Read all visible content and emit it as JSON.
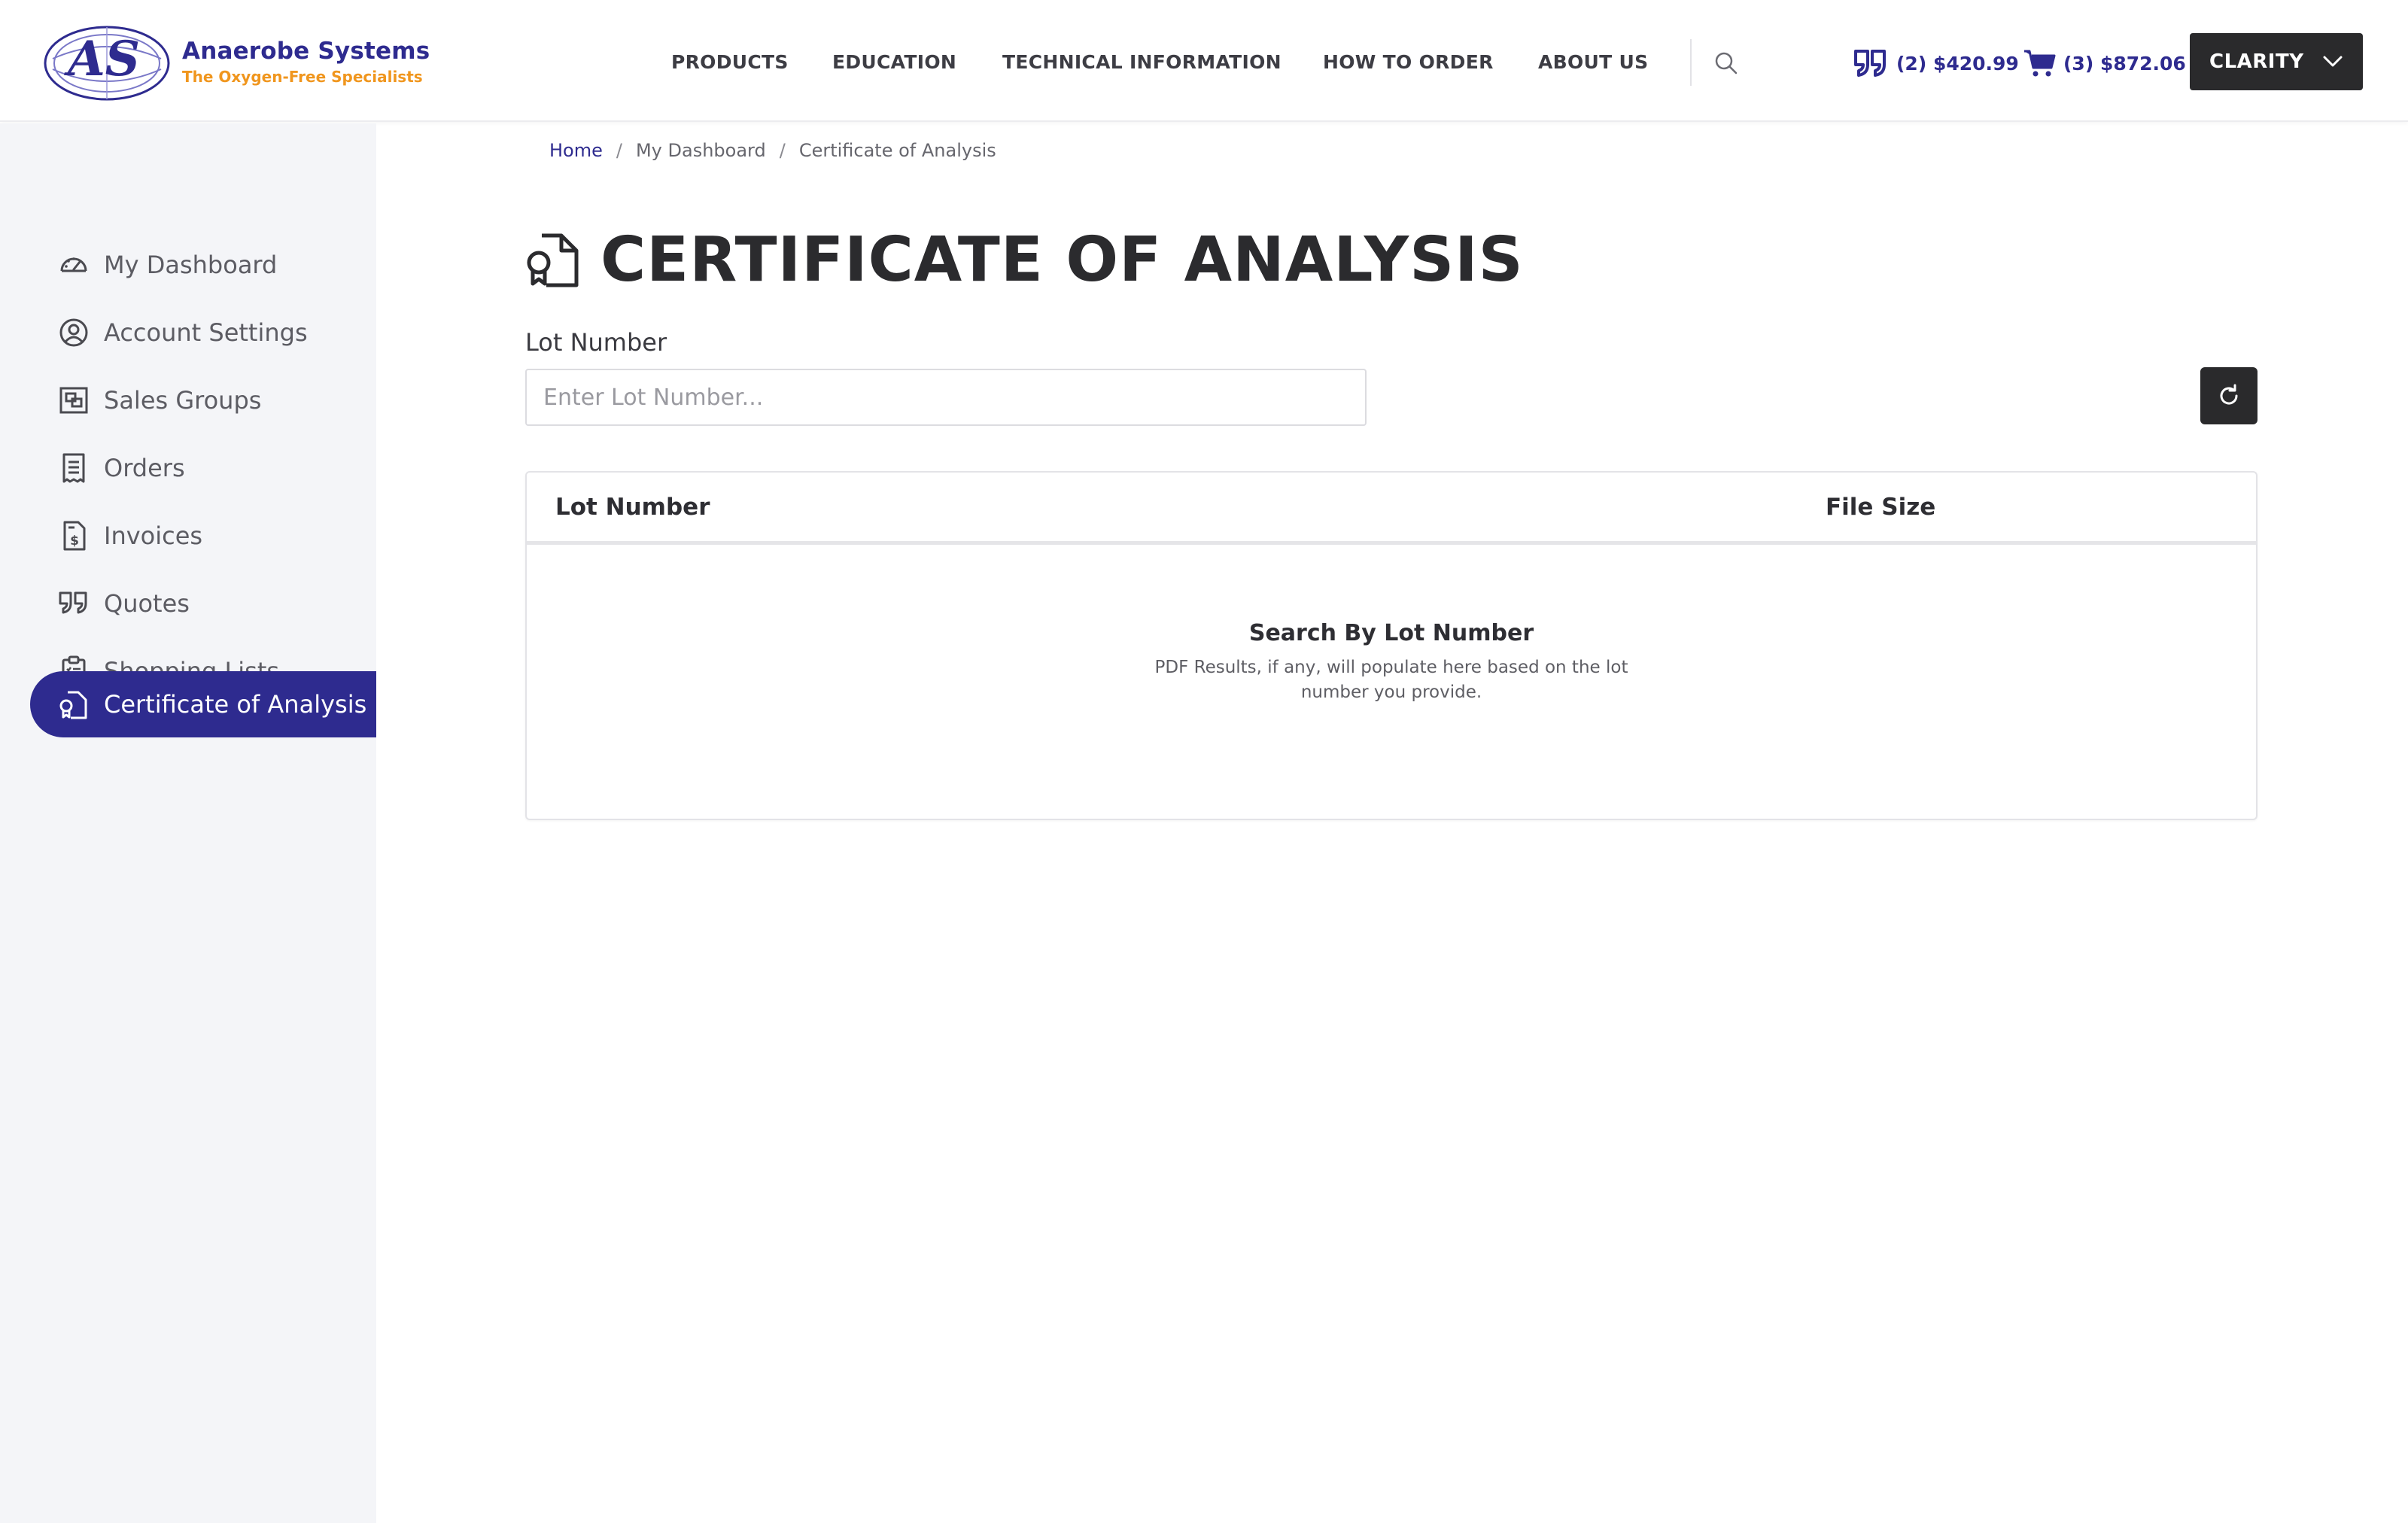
{
  "brand": {
    "name": "Anaerobe Systems",
    "tagline": "The Oxygen-Free Specialists",
    "logo_letters": "AS",
    "primary_color": "#2e2b8f",
    "accent_color": "#f0961e"
  },
  "nav": {
    "items": [
      "PRODUCTS",
      "EDUCATION",
      "TECHNICAL INFORMATION",
      "HOW TO ORDER",
      "ABOUT US"
    ],
    "search_icon": "search-icon"
  },
  "header": {
    "quotes_summary": "(2) $420.99",
    "cart_summary": "(3) $872.06",
    "account_label": "CLARITY"
  },
  "sidebar": {
    "items": [
      {
        "label": "My Dashboard",
        "icon": "dashboard-gauge-icon"
      },
      {
        "label": "Account Settings",
        "icon": "user-circle-icon"
      },
      {
        "label": "Sales Groups",
        "icon": "sales-groups-icon"
      },
      {
        "label": "Orders",
        "icon": "receipt-icon"
      },
      {
        "label": "Invoices",
        "icon": "invoice-dollar-icon"
      },
      {
        "label": "Quotes",
        "icon": "quote-icon"
      },
      {
        "label": "Shopping Lists",
        "icon": "clipboard-list-icon"
      },
      {
        "label": "Certificate of Analysis",
        "icon": "certificate-file-icon",
        "active": true
      }
    ]
  },
  "breadcrumb": {
    "home": "Home",
    "dashboard": "My Dashboard",
    "current": "Certificate of Analysis"
  },
  "page": {
    "title": "CERTIFICATE OF ANALYSIS",
    "lot_label": "Lot Number",
    "lot_value": "",
    "lot_placeholder": "Enter Lot Number..."
  },
  "table": {
    "columns": [
      "Lot Number",
      "File Size"
    ],
    "rows": [],
    "empty_title": "Search By Lot Number",
    "empty_subtitle": "PDF Results, if any, will populate here based on the lot number you provide."
  }
}
